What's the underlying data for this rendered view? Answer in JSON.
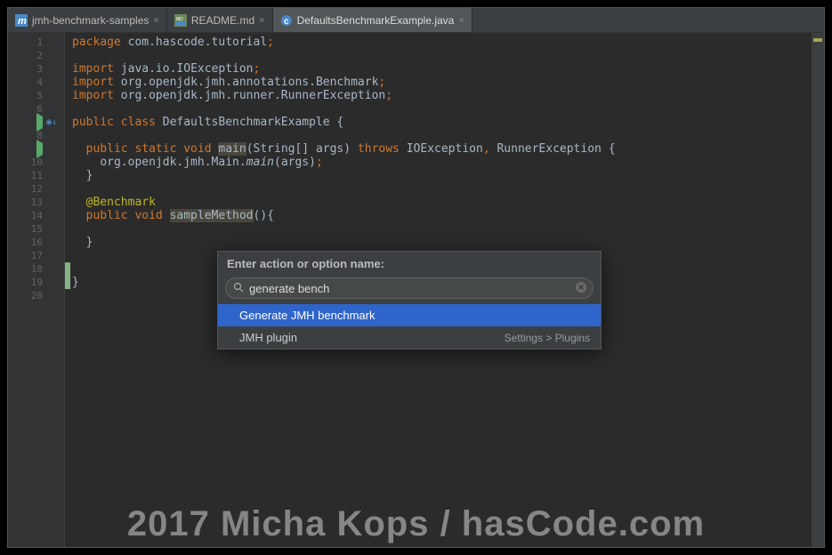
{
  "tabs": [
    {
      "label": "jmh-benchmark-samples",
      "icon": "m",
      "active": false
    },
    {
      "label": "README.md",
      "icon": "md",
      "active": false
    },
    {
      "label": "DefaultsBenchmarkExample.java",
      "icon": "class",
      "active": true
    }
  ],
  "gutter": {
    "line_count": 20,
    "run_markers": [
      7,
      9
    ],
    "implements_markers": [
      7
    ]
  },
  "code": {
    "l1": {
      "kw": "package ",
      "rest": "com.hascode.tutorial",
      "semi": ";"
    },
    "l3": {
      "kw": "import ",
      "rest": "java.io.IOException",
      "semi": ";"
    },
    "l4": {
      "kw": "import ",
      "p1": "org.openjdk.jmh.annotations.",
      "cls": "Benchmark",
      "semi": ";"
    },
    "l5": {
      "kw": "import ",
      "p1": "org.openjdk.jmh.runner.RunnerException",
      "semi": ";"
    },
    "l7": {
      "mods": "public class ",
      "name": "DefaultsBenchmarkExample",
      "brace": " {"
    },
    "l9": {
      "mods": "public static void ",
      "name": "main",
      "args_open": "(",
      "args": "String[] args",
      "args_close": ") ",
      "throws": "throws ",
      "ex1": "IOException",
      "comma": ", ",
      "ex2": "RunnerException",
      "brace": " {"
    },
    "l10": {
      "pkg": "org.openjdk.jmh.Main.",
      "method": "main",
      "args": "(args)",
      "semi": ";"
    },
    "l11": "}",
    "l13": "@Benchmark",
    "l14": {
      "mods": "public void ",
      "name": "sampleMethod",
      "rest": "(){"
    },
    "l16": "}",
    "l19": "}"
  },
  "action_popup": {
    "title": "Enter action or option name:",
    "input_value": "generate bench",
    "results": [
      {
        "label": "Generate JMH benchmark",
        "right": "",
        "selected": true
      },
      {
        "label": "JMH plugin",
        "right": "Settings > Plugins",
        "selected": false
      }
    ]
  },
  "watermark": "2017 Micha Kops / hasCode.com"
}
